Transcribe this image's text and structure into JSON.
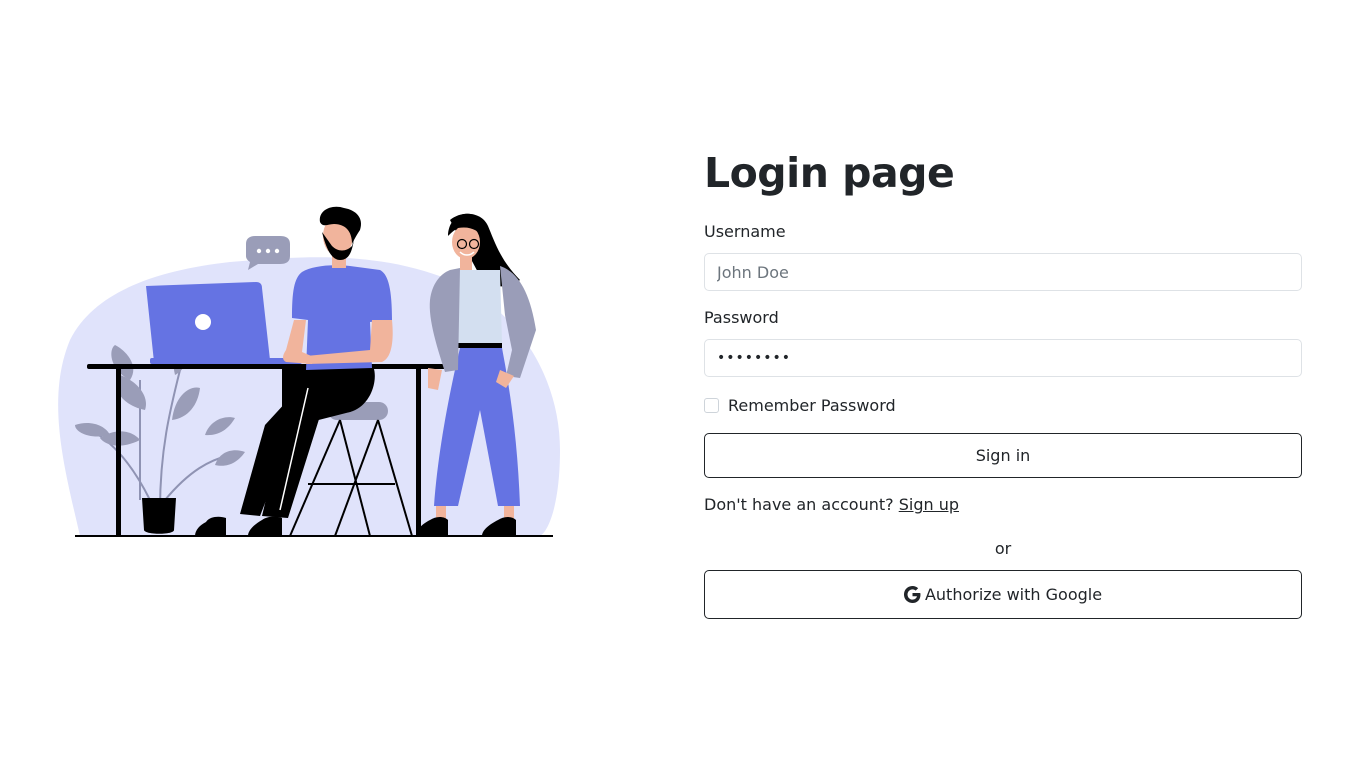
{
  "page": {
    "title": "Login page"
  },
  "form": {
    "username_label": "Username",
    "username_placeholder": "John Doe",
    "password_label": "Password",
    "password_value": "••••••••",
    "remember_label": "Remember Password",
    "signin_label": "Sign in",
    "signup_prompt": "Don't have an account?",
    "signup_link": "Sign up",
    "or_text": "or",
    "google_label": "Authorize with Google",
    "google_icon": "google-icon"
  },
  "colors": {
    "accent": "#6573e3",
    "accent_light": "#e0e3fb",
    "gray_jacket": "#9a9db8",
    "text": "#212529",
    "border": "#dee2e6"
  }
}
